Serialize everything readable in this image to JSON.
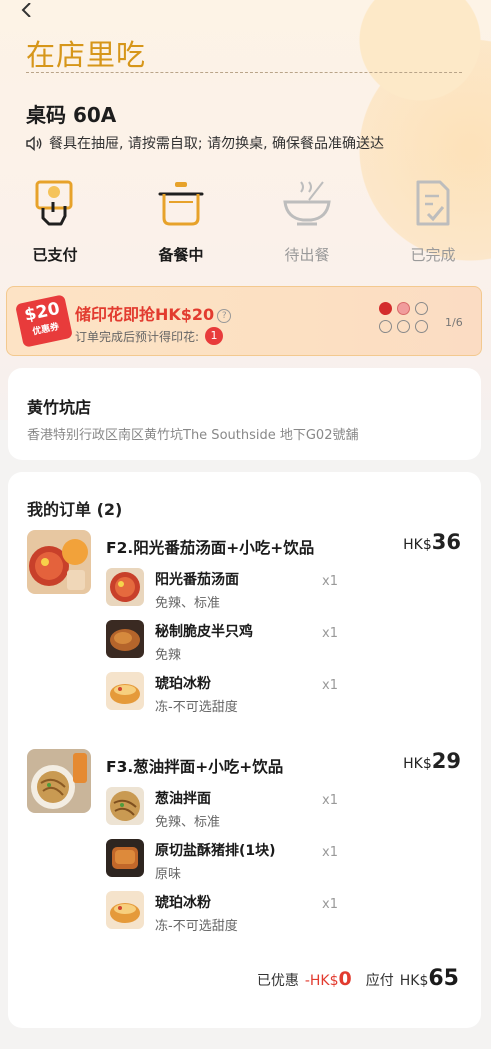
{
  "header": {
    "back_icon": "chevron-left-icon",
    "title": "在店里吃"
  },
  "table": {
    "label": "桌码 60A",
    "notice": "餐具在抽屉, 请按需自取; 请勿换桌, 确保餐品准确送达"
  },
  "progress": {
    "steps": [
      {
        "label": "已支付",
        "icon": "payment-hand-icon",
        "state": "done"
      },
      {
        "label": "备餐中",
        "icon": "cooking-pot-icon",
        "state": "done"
      },
      {
        "label": "待出餐",
        "icon": "serving-bowl-icon",
        "state": "todo"
      },
      {
        "label": "已完成",
        "icon": "checklist-icon",
        "state": "todo"
      }
    ],
    "ellipsis": "..."
  },
  "banner": {
    "coupon_amount": "$20",
    "coupon_tag": "优惠券",
    "title": "储印花即抢HK$20",
    "help_icon": "?",
    "subtitle": "订单完成后预计得印花:",
    "stamp_count": "1",
    "page_indicator": "1/6",
    "stamps_filled": 1,
    "stamps_partial": 1,
    "stamps_total": 6
  },
  "store": {
    "name": "黄竹坑店",
    "address": "香港特别行政区南区黄竹坑The Southside 地下G02號舖"
  },
  "order": {
    "heading": "我的订单 (2)",
    "combos": [
      {
        "name": "F2.阳光番茄汤面+小吃+饮品",
        "currency": "HK$",
        "price": "36",
        "items": [
          {
            "name": "阳光番茄汤面",
            "spec": "免辣、标准",
            "qty": "x1"
          },
          {
            "name": "秘制脆皮半只鸡",
            "spec": "免辣",
            "qty": "x1"
          },
          {
            "name": "琥珀冰粉",
            "spec": "冻-不可选甜度",
            "qty": "x1"
          }
        ]
      },
      {
        "name": "F3.葱油拌面+小吃+饮品",
        "currency": "HK$",
        "price": "29",
        "items": [
          {
            "name": "葱油拌面",
            "spec": "免辣、标准",
            "qty": "x1"
          },
          {
            "name": "原切盐酥猪排(1块)",
            "spec": "原味",
            "qty": "x1"
          },
          {
            "name": "琥珀冰粉",
            "spec": "冻-不可选甜度",
            "qty": "x1"
          }
        ]
      }
    ],
    "discount_label": "已优惠",
    "discount_prefix": "-HK$",
    "discount_value": "0",
    "pay_label": "应付",
    "pay_currency": "HK$",
    "pay_value": "65"
  },
  "colors": {
    "accent_gold": "#d6961a",
    "alert_red": "#e23b2f"
  }
}
